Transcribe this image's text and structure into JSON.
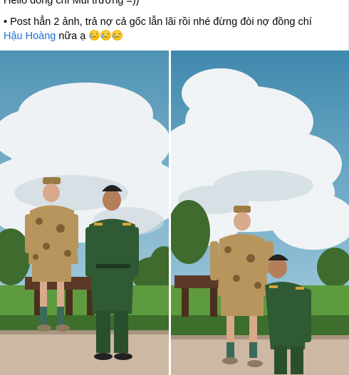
{
  "post": {
    "line1": "Hello đồng chí Mũi trưởng =))",
    "line2_prefix": "• Post hẳn 2 ảnh, trả nợ cả gốc lẫn lãi rồi nhé đừng đòi nợ đồng chí",
    "mention": "Hậu Hoàng",
    "line3_suffix": " nữa ạ",
    "emojis": [
      "crying-face-emoji",
      "crying-face-emoji",
      "crying-face-emoji"
    ]
  },
  "photos": [
    {
      "name": "photo-left",
      "subject": "two-people-camouflage-and-military-uniform"
    },
    {
      "name": "photo-right",
      "subject": "two-people-camouflage-and-military-uniform-leaning"
    }
  ],
  "colors": {
    "mention": "#216fdb",
    "sky": "#6aa8c6",
    "cloud": "#f1f4f6",
    "grass": "#5e9a3e",
    "path": "#cdb8a3",
    "military_green": "#2f5a33",
    "camo": "#b8955c"
  }
}
